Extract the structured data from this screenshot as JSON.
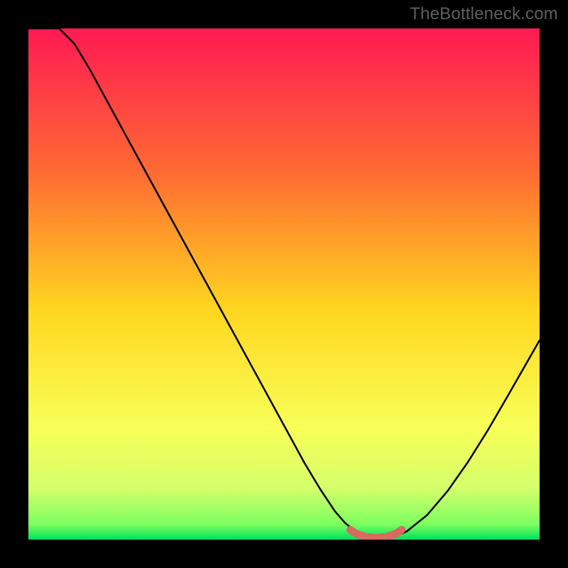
{
  "watermark": "TheBottleneck.com",
  "colors": {
    "page_bg": "#000000",
    "watermark": "#5e5e5e",
    "curve": "#000000",
    "flat_segment": "#d86a60",
    "gradient_top": "#ff1a53",
    "gradient_upper_mid": "#ff7a2a",
    "gradient_mid": "#ffd61f",
    "gradient_lower_mid": "#f8ff57",
    "gradient_near_bottom": "#d4ff6b",
    "gradient_bottom": "#00e05a"
  },
  "chart_data": {
    "type": "line",
    "title": "",
    "xlabel": "",
    "ylabel": "",
    "xlim": [
      0,
      100
    ],
    "ylim": [
      0,
      100
    ],
    "series": [
      {
        "name": "bottleneck-curve",
        "x": [
          0,
          3,
          6,
          9,
          12,
          15,
          18,
          21,
          24,
          27,
          30,
          33,
          36,
          39,
          42,
          45,
          48,
          51,
          54,
          57,
          60,
          62,
          64,
          66,
          68,
          70,
          72,
          74,
          78,
          82,
          86,
          90,
          94,
          98,
          100
        ],
        "y": [
          100,
          100,
          100,
          97,
          92,
          86.5,
          81,
          75.5,
          70,
          64.5,
          59,
          53.5,
          48,
          42.5,
          37,
          31.5,
          26,
          20.5,
          15,
          10,
          5.5,
          3.2,
          1.6,
          0.7,
          0.3,
          0.3,
          0.7,
          1.6,
          4.8,
          9.5,
          15.2,
          21.6,
          28.5,
          35.5,
          39
        ]
      },
      {
        "name": "flat-segment",
        "x": [
          63,
          64,
          66,
          68,
          70,
          72,
          73
        ],
        "y": [
          1.9,
          1.2,
          0.5,
          0.3,
          0.5,
          1.2,
          1.9
        ]
      }
    ],
    "notes": "Values estimated from pixels; y=0 corresponds to the bottom green band, y=100 to the top red band. x is horizontal position as percentage of inner plot width."
  }
}
